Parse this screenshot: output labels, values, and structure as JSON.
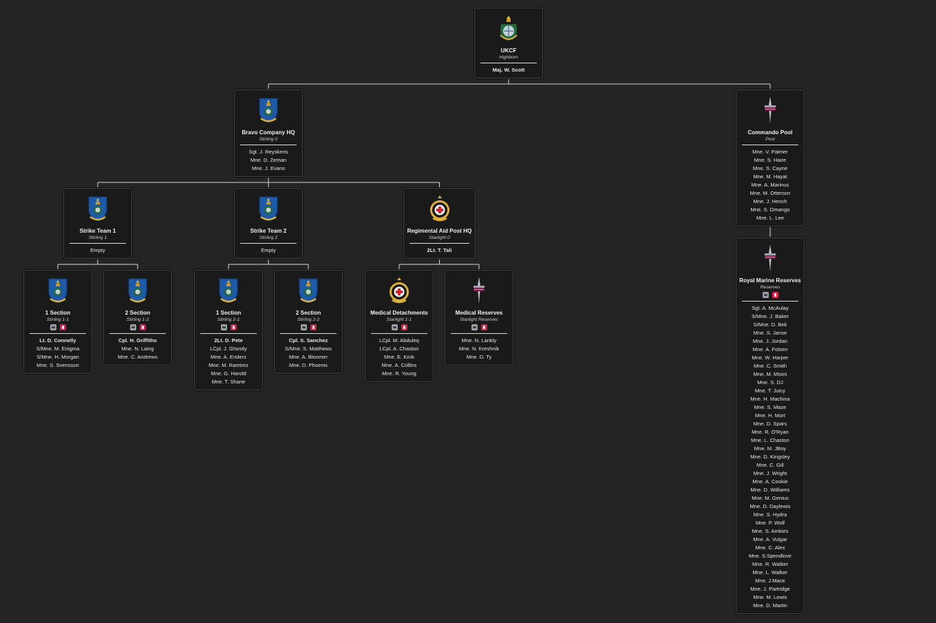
{
  "units": [
    {
      "id": "ukcf",
      "name": "UKCF",
      "callsign": "Highborn",
      "emblem": "rm-globe-crest-icon",
      "badges": false,
      "members": [
        {
          "name": "Maj. W. Scott",
          "lead": true
        }
      ]
    },
    {
      "id": "bravo",
      "name": "Bravo Company HQ",
      "callsign": "Stirling 0",
      "emblem": "blue-shield-crest-icon",
      "badges": false,
      "members": [
        {
          "name": "Sgt. J. Reyskens"
        },
        {
          "name": "Mne. D. Zeman"
        },
        {
          "name": "Mne. J. Evans"
        }
      ]
    },
    {
      "id": "pool",
      "name": "Commando Pool",
      "callsign": "Pool",
      "emblem": "commando-dagger-icon",
      "badges": false,
      "members": [
        {
          "name": "Mne. V. Palmer"
        },
        {
          "name": "Mne. S. Haire"
        },
        {
          "name": "Mne. S. Cayne"
        },
        {
          "name": "Mne. M. Hayat"
        },
        {
          "name": "Mne. A. Marinus"
        },
        {
          "name": "Mne. M. Otterson"
        },
        {
          "name": "Mne. J. Hench"
        },
        {
          "name": "Mne. S. Dmango"
        },
        {
          "name": "Mne. L. Lee"
        }
      ]
    },
    {
      "id": "st1",
      "name": "Strike Team 1",
      "callsign": "Stirling 1",
      "emblem": "blue-shield-crest-icon",
      "badges": false,
      "members": [
        {
          "name": "Empty"
        }
      ]
    },
    {
      "id": "st2",
      "name": "Strike Team 2",
      "callsign": "Stirling 2",
      "emblem": "blue-shield-crest-icon",
      "badges": false,
      "members": [
        {
          "name": "Empty"
        }
      ]
    },
    {
      "id": "rap",
      "name": "Regimental Aid Post HQ",
      "callsign": "Starlight 0",
      "emblem": "medical-crest-icon",
      "badges": false,
      "members": [
        {
          "name": "2Lt. T. Tali",
          "lead": true
        }
      ]
    },
    {
      "id": "s11",
      "name": "1 Section",
      "callsign": "Stirling 1-1",
      "emblem": "blue-shield-crest-icon",
      "badges": true,
      "members": [
        {
          "name": "Lt. D. Connelly",
          "lead": true
        },
        {
          "name": "S/Mne. M. Enigma"
        },
        {
          "name": "S/Mne. H. Morgan"
        },
        {
          "name": "Mne. S. Svensson"
        }
      ]
    },
    {
      "id": "s12",
      "name": "2 Section",
      "callsign": "Stirling 1-2",
      "emblem": "blue-shield-crest-icon",
      "badges": true,
      "members": [
        {
          "name": "Cpl. H. Griffiths",
          "lead": true
        },
        {
          "name": "Mne. N. Laing"
        },
        {
          "name": "Mne. C. Andrews"
        }
      ]
    },
    {
      "id": "s21",
      "name": "1 Section",
      "callsign": "Stirling 2-1",
      "emblem": "blue-shield-crest-icon",
      "badges": true,
      "members": [
        {
          "name": "2Lt. D. Pete",
          "lead": true
        },
        {
          "name": "LCpl. J. Ghostly"
        },
        {
          "name": "Mne. A. Enderz"
        },
        {
          "name": "Mne. M. Ramirez"
        },
        {
          "name": "Mne. G. Harold"
        },
        {
          "name": "Mne. T. Shane"
        }
      ]
    },
    {
      "id": "s22",
      "name": "2 Section",
      "callsign": "Stirling 2-2",
      "emblem": "blue-shield-crest-icon",
      "badges": true,
      "members": [
        {
          "name": "Cpl. S. Sanchez",
          "lead": true
        },
        {
          "name": "S/Mne. S. Matthews"
        },
        {
          "name": "Mne. A. Bloomer"
        },
        {
          "name": "Mne. D. Phoenix"
        }
      ]
    },
    {
      "id": "med",
      "name": "Medical Detachments",
      "callsign": "Starlight 1-1",
      "emblem": "medical-crest-icon",
      "badges": true,
      "members": [
        {
          "name": "LCpl. M. Abduleq"
        },
        {
          "name": "LCpl. A. Chaston"
        },
        {
          "name": "Mne. E. Krok"
        },
        {
          "name": "Mne. A. Collins"
        },
        {
          "name": "Mne. R. Young"
        }
      ]
    },
    {
      "id": "medres",
      "name": "Medical Reserves",
      "callsign": "Starlight Reserves",
      "emblem": "commando-dagger-icon",
      "badges": true,
      "members": [
        {
          "name": "Mne. N. Lankly"
        },
        {
          "name": "Mne. N. Kreshnik"
        },
        {
          "name": "Mne. D. Ty"
        }
      ]
    },
    {
      "id": "rmr",
      "name": "Royal Marine Reserves",
      "callsign": "Reserves",
      "emblem": "commando-dagger-icon",
      "badges": true,
      "members": [
        {
          "name": "Sgt. A. McAulay"
        },
        {
          "name": "S/Mne. J. Baker"
        },
        {
          "name": "S/Mne. D. Bek"
        },
        {
          "name": "Mne. S. Janse"
        },
        {
          "name": "Mne. J. Jordan"
        },
        {
          "name": "Mne. A. Folsen"
        },
        {
          "name": "Mne. W. Harper"
        },
        {
          "name": "Mne. C. Smith"
        },
        {
          "name": "Mne. M. Misini"
        },
        {
          "name": "Mne. S. DJ"
        },
        {
          "name": "Mne. T. Juicy"
        },
        {
          "name": "Mne. H. Machina"
        },
        {
          "name": "Mne. S. Maze"
        },
        {
          "name": "Mne. H. Mort"
        },
        {
          "name": "Mne. D. Spars"
        },
        {
          "name": "Mne. R. O'Ryan"
        },
        {
          "name": "Mne. L. Chaston"
        },
        {
          "name": "Mne. M. JBoy"
        },
        {
          "name": "Mne. D. Kingsley"
        },
        {
          "name": "Mne. C. Gill"
        },
        {
          "name": "Mne. J. Wright"
        },
        {
          "name": "Mne. A. Cookie"
        },
        {
          "name": "Mne. D. Williams"
        },
        {
          "name": "Mne. M. Genius"
        },
        {
          "name": "Mne. D. Daylewis"
        },
        {
          "name": "Mne. S. Hydra"
        },
        {
          "name": "Mne. P. Wolf"
        },
        {
          "name": "Mne. S. Amkies"
        },
        {
          "name": "Mne. A. Vulgar"
        },
        {
          "name": "Mne. C. Alex"
        },
        {
          "name": "Mne. S.Spendlove"
        },
        {
          "name": "Mne. R. Walker"
        },
        {
          "name": "Mne. L. Walker"
        },
        {
          "name": "Mne. J.Mace"
        },
        {
          "name": "Mne. J. Partridge"
        },
        {
          "name": "Mne. M. Lewis"
        },
        {
          "name": "Mne. D. Martin"
        }
      ]
    }
  ],
  "hierarchy": [
    {
      "parent": "ukcf",
      "children": [
        "bravo",
        "pool"
      ]
    },
    {
      "parent": "bravo",
      "children": [
        "st1",
        "st2",
        "rap"
      ]
    },
    {
      "parent": "pool",
      "children": [
        "rmr"
      ]
    },
    {
      "parent": "st1",
      "children": [
        "s11",
        "s12"
      ]
    },
    {
      "parent": "st2",
      "children": [
        "s21",
        "s22"
      ]
    },
    {
      "parent": "rap",
      "children": [
        "med",
        "medres"
      ]
    }
  ],
  "colors": {
    "background": "#242424",
    "card": "#1a1a1a",
    "connector": "#d8d8d8",
    "badge_grey": "#9aa0a8",
    "badge_red": "#e01e46"
  }
}
